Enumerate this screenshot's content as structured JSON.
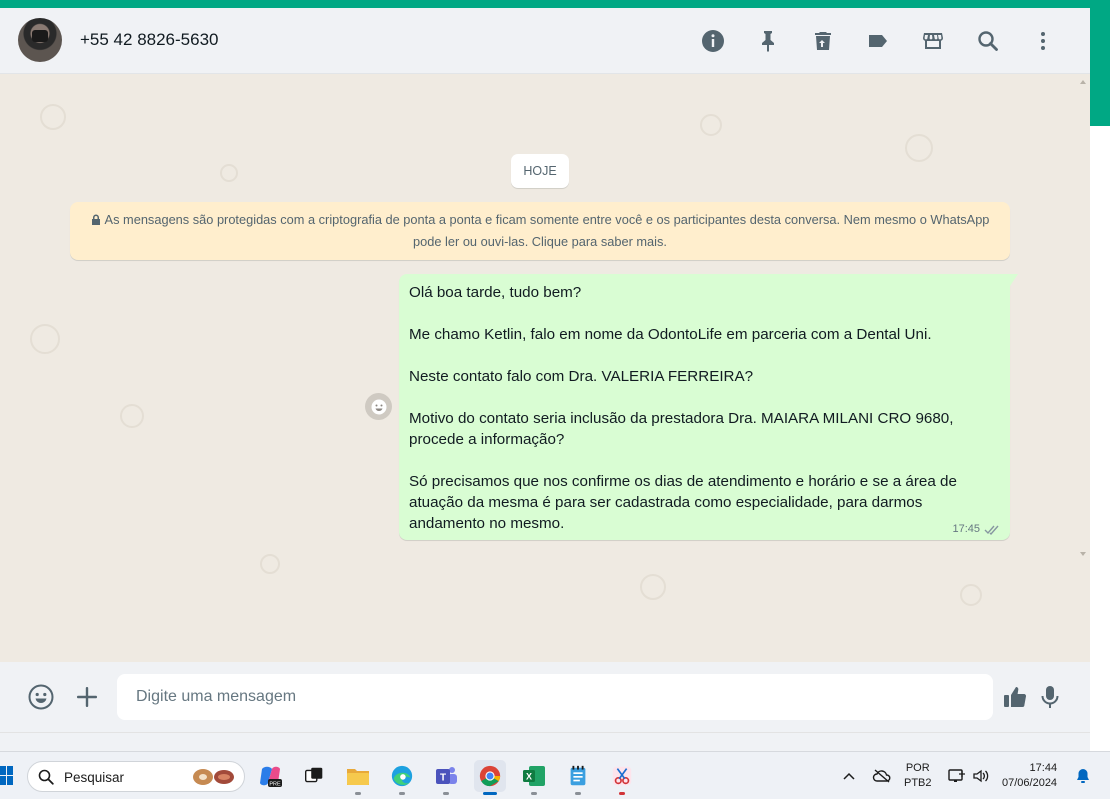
{
  "header": {
    "contact_name": "+55 42 8826-5630",
    "icons": [
      "info-icon",
      "pin-icon",
      "delete-icon",
      "label-icon",
      "store-icon",
      "search-icon",
      "menu-icon"
    ]
  },
  "chat": {
    "date_chip": "HOJE",
    "encryption_notice": "As mensagens são protegidas com a criptografia de ponta a ponta e ficam somente entre você e os participantes desta conversa. Nem mesmo o WhatsApp pode ler ou ouvi-las. Clique para saber mais.",
    "message": {
      "text": "Olá boa tarde, tudo bem?\n\nMe chamo Ketlin, falo em nome da OdontoLife em parceria com a Dental Uni.\n\nNeste contato falo com Dra. VALERIA FERREIRA?\n\nMotivo do contato seria inclusão da prestadora Dra. MAIARA MILANI CRO 9680, procede a informação?\n\nSó precisamos que nos confirme os dias de atendimento e horário e se a área de atuação da mesma é para ser cadastrada como especialidade, para darmos andamento no mesmo.",
      "time": "17:45",
      "status": "delivered"
    }
  },
  "composer": {
    "placeholder": "Digite uma mensagem"
  },
  "taskbar": {
    "search_label": "Pesquisar",
    "language_line1": "POR",
    "language_line2": "PTB2",
    "time": "17:44",
    "date": "07/06/2024",
    "apps": [
      "copilot",
      "task-view",
      "file-explorer",
      "edge",
      "teams",
      "chrome",
      "excel",
      "notepad",
      "snipping-tool"
    ]
  },
  "colors": {
    "accent": "#00a884",
    "outgoing_bubble": "#d9fdd3",
    "chat_background": "#efeae2",
    "encryption_notice": "#ffeecd"
  }
}
